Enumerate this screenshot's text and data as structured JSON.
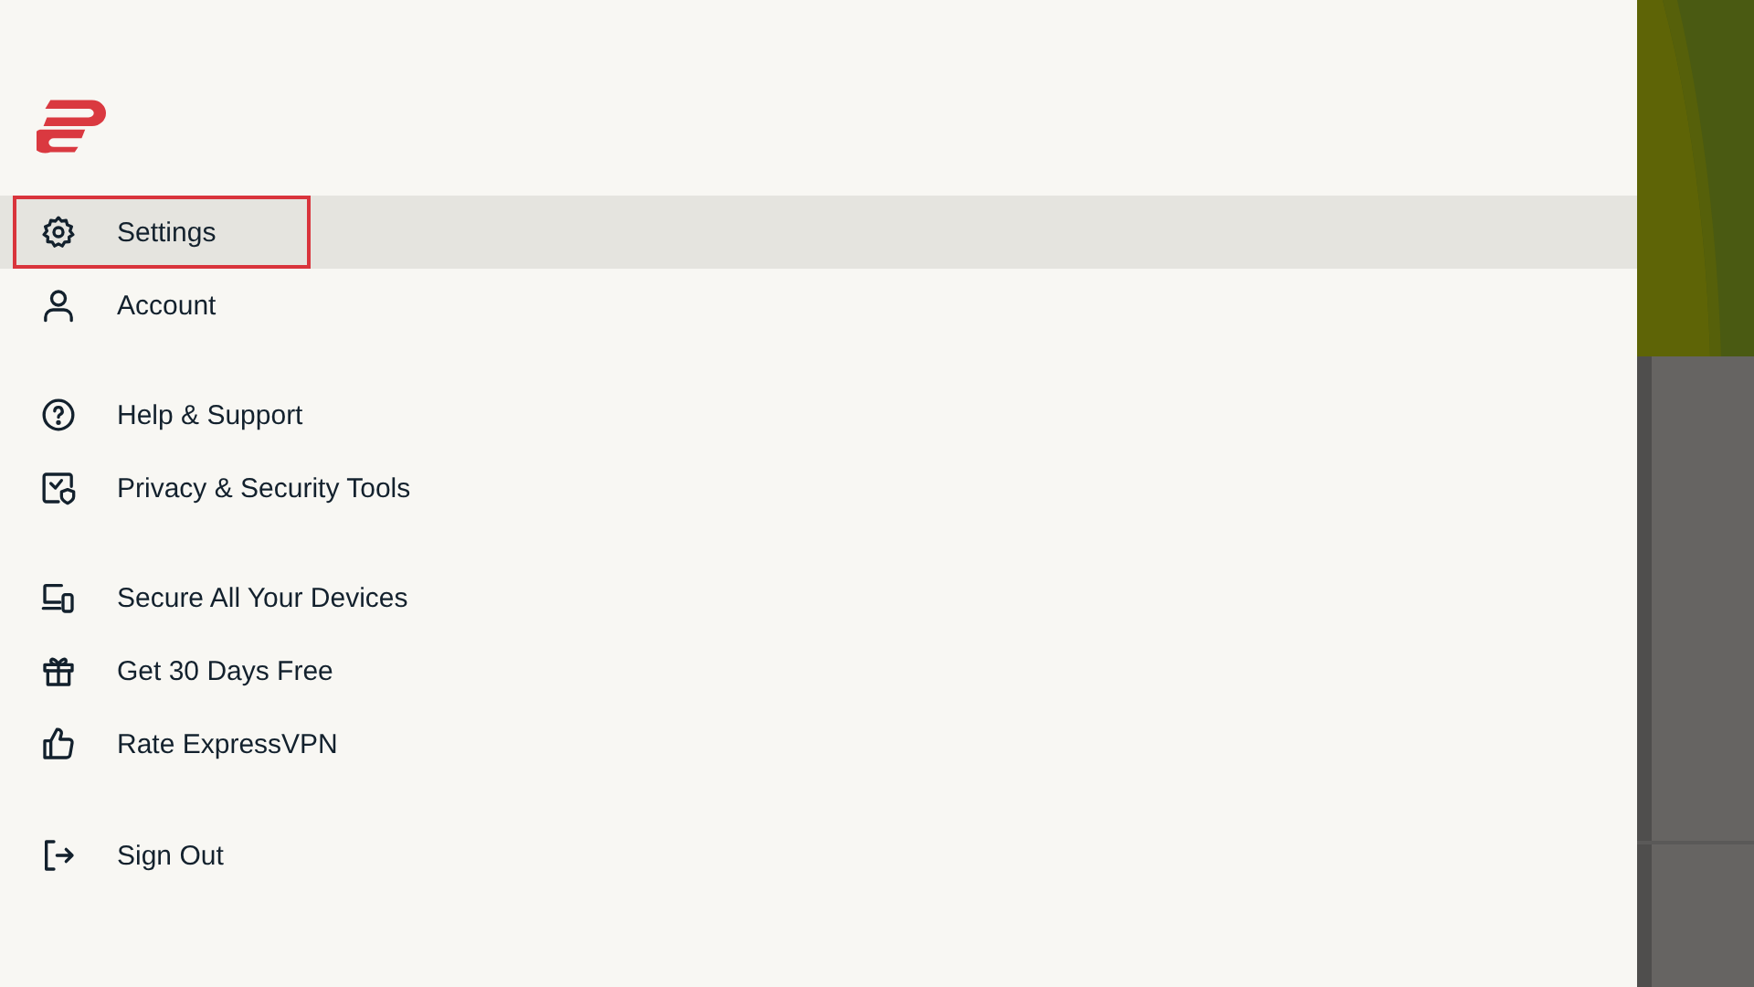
{
  "menu": {
    "groups": [
      [
        {
          "label": "Settings",
          "kind": "gear",
          "selected": true
        },
        {
          "label": "Account",
          "kind": "person",
          "selected": false
        }
      ],
      [
        {
          "label": "Help & Support",
          "kind": "help",
          "selected": false
        },
        {
          "label": "Privacy & Security Tools",
          "kind": "shield",
          "selected": false
        }
      ],
      [
        {
          "label": "Secure All Your Devices",
          "kind": "devices",
          "selected": false
        },
        {
          "label": "Get 30 Days Free",
          "kind": "gift",
          "selected": false
        },
        {
          "label": "Rate ExpressVPN",
          "kind": "thumb",
          "selected": false
        }
      ],
      [
        {
          "label": "Sign Out",
          "kind": "signout",
          "selected": false
        }
      ]
    ]
  }
}
